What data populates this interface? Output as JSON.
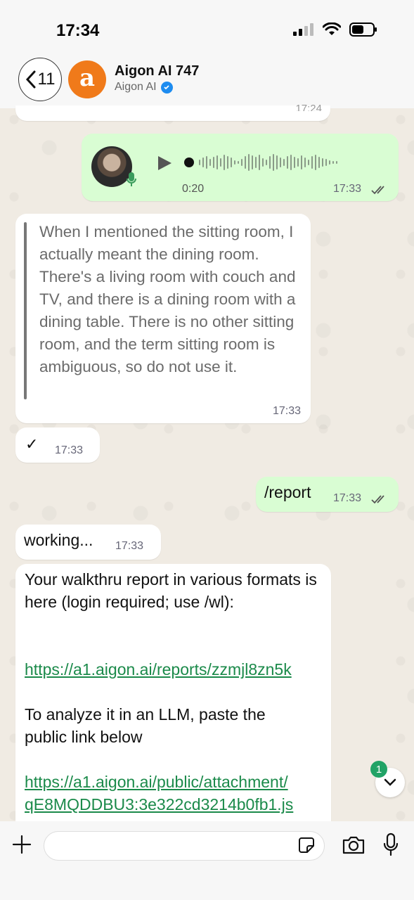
{
  "status_bar": {
    "time": "17:34"
  },
  "header": {
    "back_count": "11",
    "avatar_letter": "a",
    "contact_name": "Aigon AI 747",
    "contact_subtitle": "Aigon AI"
  },
  "messages": {
    "cut_top_time": "17:24",
    "voice": {
      "duration": "0:20",
      "time": "17:33"
    },
    "quoted": {
      "text": "When I mentioned the sitting room, I actually meant the dining room. There's a living room with couch and TV, and there is a dining room with a dining table. There is no other sitting room, and the term sitting room is ambiguous, so do not use it.",
      "time": "17:33"
    },
    "check": {
      "text": "✓",
      "time": "17:33"
    },
    "report_cmd": {
      "text": "/report",
      "time": "17:33"
    },
    "working": {
      "text": "working...",
      "time": "17:33"
    },
    "report": {
      "intro": "Your walkthru report in various formats is here (login required; use /wl):",
      "link1": "https://a1.aigon.ai/reports/zzmjl8zn5k",
      "analyze": "To analyze it in an LLM, paste the public link below",
      "link2a": "https://a1.aigon.ai/public/attachment/",
      "link2b": "qE8MQDDBU3:3e322cd3214b0fb1.js"
    }
  },
  "scroll": {
    "unread": "1"
  },
  "composer": {
    "value": ""
  },
  "colors": {
    "outgoing": "#d9fdd3",
    "incoming": "#ffffff",
    "link": "#1b8a4a",
    "accent": "#21a366",
    "avatar": "#f07a1a"
  }
}
